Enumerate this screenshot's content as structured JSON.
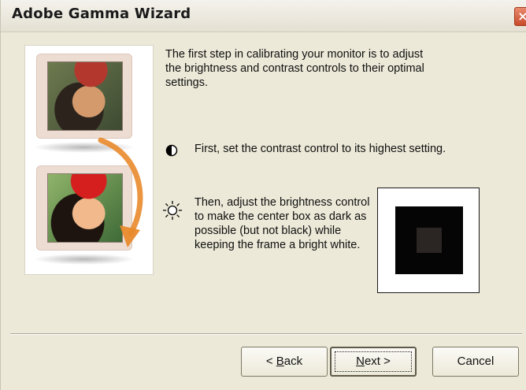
{
  "window": {
    "title": "Adobe Gamma Wizard",
    "close_label": "×"
  },
  "content": {
    "intro": "The first step in calibrating your monitor is to adjust the brightness and contrast controls to their optimal settings.",
    "contrast_instruction": "First, set the contrast control to its highest setting.",
    "brightness_instruction": "Then, adjust the brightness control to make the center box as dark as possible (but not black) while keeping the frame a bright white.",
    "icons": {
      "contrast": "contrast-icon",
      "brightness": "sun-icon"
    }
  },
  "buttons": {
    "back": {
      "prefix": "< ",
      "mnemonic": "B",
      "rest": "ack"
    },
    "next": {
      "mnemonic": "N",
      "rest": "ext >"
    },
    "cancel": "Cancel"
  },
  "colors": {
    "dialog_bg": "#ece9d8",
    "gamma_frame": "#ffffff",
    "gamma_dark": "#050505",
    "gamma_center": "#2b2523",
    "arrow": "#e98a2c"
  }
}
